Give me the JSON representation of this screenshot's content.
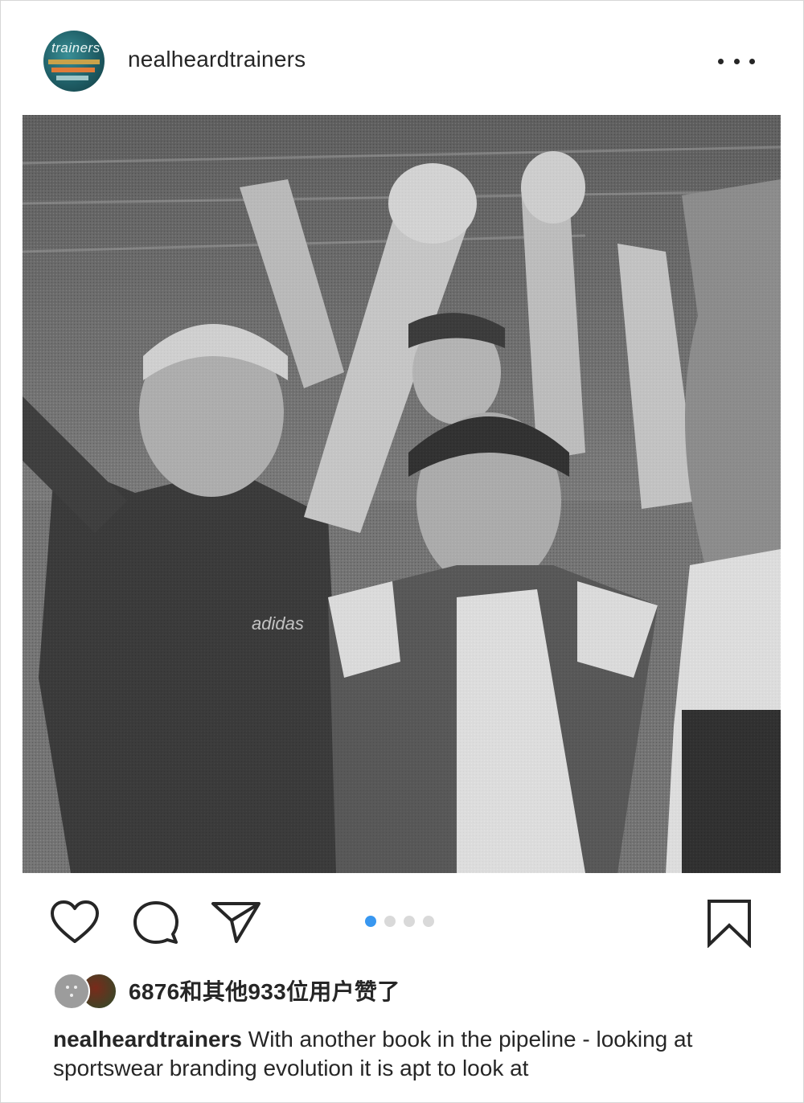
{
  "post": {
    "username": "nealheardtrainers",
    "avatar_text": "trainers",
    "more_icon": "more-horizontal-icon",
    "photo_alt": "",
    "carousel": {
      "count": 4,
      "active_index": 0
    },
    "likes": {
      "text": "6876和其他933位用户赞了"
    },
    "caption": {
      "username": "nealheardtrainers",
      "text": "With another book in the pipeline - looking at sportswear branding evolution it is apt to look at"
    }
  },
  "icons": {
    "like": "heart-icon",
    "comment": "comment-icon",
    "share": "paper-plane-icon",
    "save": "bookmark-icon"
  },
  "colors": {
    "text": "#262626",
    "accent": "#3897f0",
    "inactive_dot": "#d9d9d9"
  }
}
